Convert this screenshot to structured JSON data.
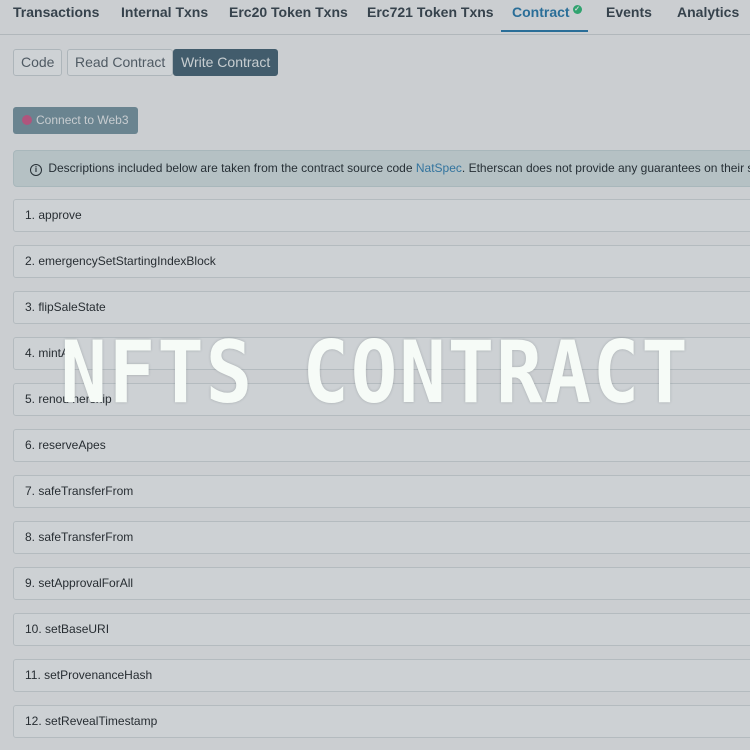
{
  "tabs": [
    {
      "label": "Transactions"
    },
    {
      "label": "Internal Txns"
    },
    {
      "label": "Erc20 Token Txns"
    },
    {
      "label": "Erc721 Token Txns"
    },
    {
      "label": "Contract"
    },
    {
      "label": "Events"
    },
    {
      "label": "Analytics"
    }
  ],
  "sub_tabs": {
    "code": "Code",
    "read": "Read Contract",
    "write": "Write Contract"
  },
  "connect": {
    "label": "Connect to Web3"
  },
  "info": {
    "prefix": "Descriptions included below are taken from the contract source code ",
    "link": "NatSpec",
    "suffix": ". Etherscan does not provide any guarantees on their saf"
  },
  "functions": [
    "1. approve",
    "2. emergencySetStartingIndexBlock",
    "3. flipSaleState",
    "4. mintA",
    "5. renou              nership",
    "6. reserveApes",
    "7. safeTransferFrom",
    "8. safeTransferFrom",
    "9. setApprovalForAll",
    "10. setBaseURI",
    "11. setProvenanceHash",
    "12. setRevealTimestamp"
  ],
  "overlay": {
    "title": "NFTS CONTRACT"
  },
  "colors": {
    "accent": "#2f7fb0",
    "verified_check": "#37c07e",
    "write_active": "#4c6a7a"
  }
}
